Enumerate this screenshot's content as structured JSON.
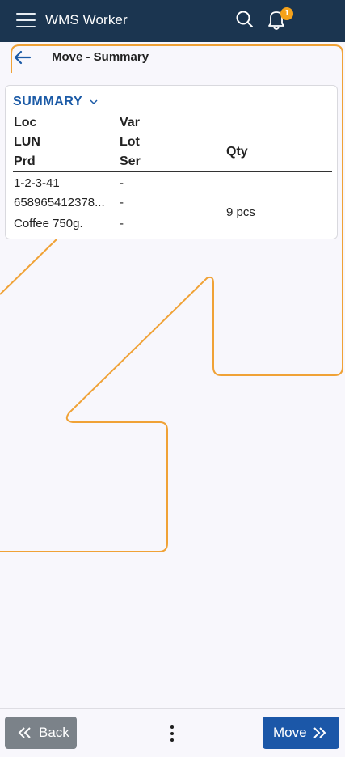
{
  "header": {
    "app_title": "WMS Worker",
    "notification_count": "1",
    "icons": [
      "menu-icon",
      "search-icon",
      "bell-icon"
    ]
  },
  "subbar": {
    "title": "Move - Summary",
    "back_icon": "arrow-left-icon"
  },
  "summary": {
    "heading": "SUMMARY",
    "columns": {
      "loc": "Loc",
      "lun": "LUN",
      "prd": "Prd",
      "var": "Var",
      "lot": "Lot",
      "ser": "Ser",
      "qty": "Qty"
    },
    "row": {
      "loc": "1-2-3-41",
      "lun": "658965412378...",
      "prd": "Coffee 750g.",
      "var": "-",
      "lot": "-",
      "ser": "-",
      "qty": "9 pcs"
    }
  },
  "footer": {
    "back_label": "Back",
    "move_label": "Move"
  },
  "colors": {
    "header_bg": "#1b3550",
    "accent": "#1b5aa6",
    "badge": "#f5a21b",
    "back_button": "#7b8289",
    "move_button": "#1b57a8",
    "decor_line": "#f0a236"
  }
}
